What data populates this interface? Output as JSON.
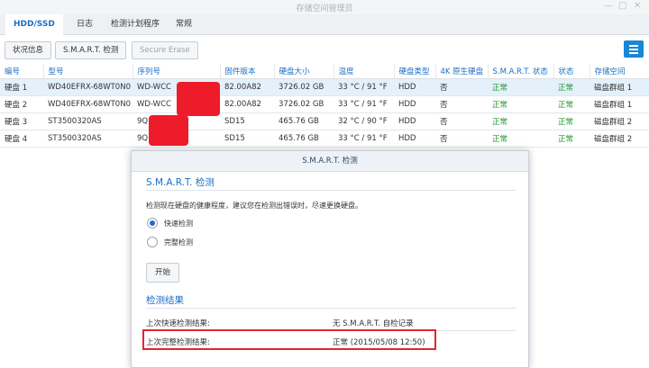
{
  "window": {
    "title": "存储空间管理员"
  },
  "tabs": [
    {
      "label": "HDD/SSD"
    },
    {
      "label": "日志"
    },
    {
      "label": "检测计划程序"
    },
    {
      "label": "常规"
    }
  ],
  "toolbar": {
    "status_label": "状况信息",
    "smart_label": "S.M.A.R.T. 检测",
    "secure_erase_label": "Secure Erase"
  },
  "table": {
    "columns": [
      "编号",
      "型号",
      "序列号",
      "固件版本",
      "硬盘大小",
      "温度",
      "硬盘类型",
      "4K 原生硬盘",
      "S.M.A.R.T. 状态",
      "状态",
      "存储空间"
    ],
    "rows": [
      [
        "硬盘 1",
        "WD40EFRX-68WT0N0",
        "WD-WCC",
        "82.00A82",
        "3726.02 GB",
        "33 °C / 91 °F",
        "HDD",
        "否",
        "正常",
        "正常",
        "磁盘群组 1"
      ],
      [
        "硬盘 2",
        "WD40EFRX-68WT0N0",
        "WD-WCC",
        "82.00A82",
        "3726.02 GB",
        "33 °C / 91 °F",
        "HDD",
        "否",
        "正常",
        "正常",
        "磁盘群组 1"
      ],
      [
        "硬盘 3",
        "ST3500320AS",
        "9Q",
        "SD15",
        "465.76 GB",
        "32 °C / 90 °F",
        "HDD",
        "否",
        "正常",
        "正常",
        "磁盘群组 2"
      ],
      [
        "硬盘 4",
        "ST3500320AS",
        "9Q",
        "SD15",
        "465.76 GB",
        "33 °C / 91 °F",
        "HDD",
        "否",
        "正常",
        "正常",
        "磁盘群组 2"
      ]
    ]
  },
  "dialog": {
    "title": "S.M.A.R.T. 检测",
    "section_smart": "S.M.A.R.T. 检测",
    "description": "检测现在硬盘的健康程度，建议您在检测出错误时，尽速更换硬盘。",
    "option_quick": "快速检测",
    "option_full": "完整检测",
    "start_label": "开始",
    "section_results": "检测结果",
    "last_quick_label": "上次快速检测结果:",
    "last_quick_value": "无 S.M.A.R.T. 自检记录",
    "last_full_label": "上次完整检测结果:",
    "last_full_value": "正常 (2015/05/08 12:50)"
  },
  "colors": {
    "accent": "#1a6fc7",
    "ok": "#1e9a2c",
    "redaction": "#ee1c2b",
    "highlight": "#e8222f"
  },
  "icons": {
    "menu": "hamburger-menu-icon",
    "window_controls": [
      "minimize-icon",
      "maximize-icon",
      "close-icon"
    ]
  }
}
